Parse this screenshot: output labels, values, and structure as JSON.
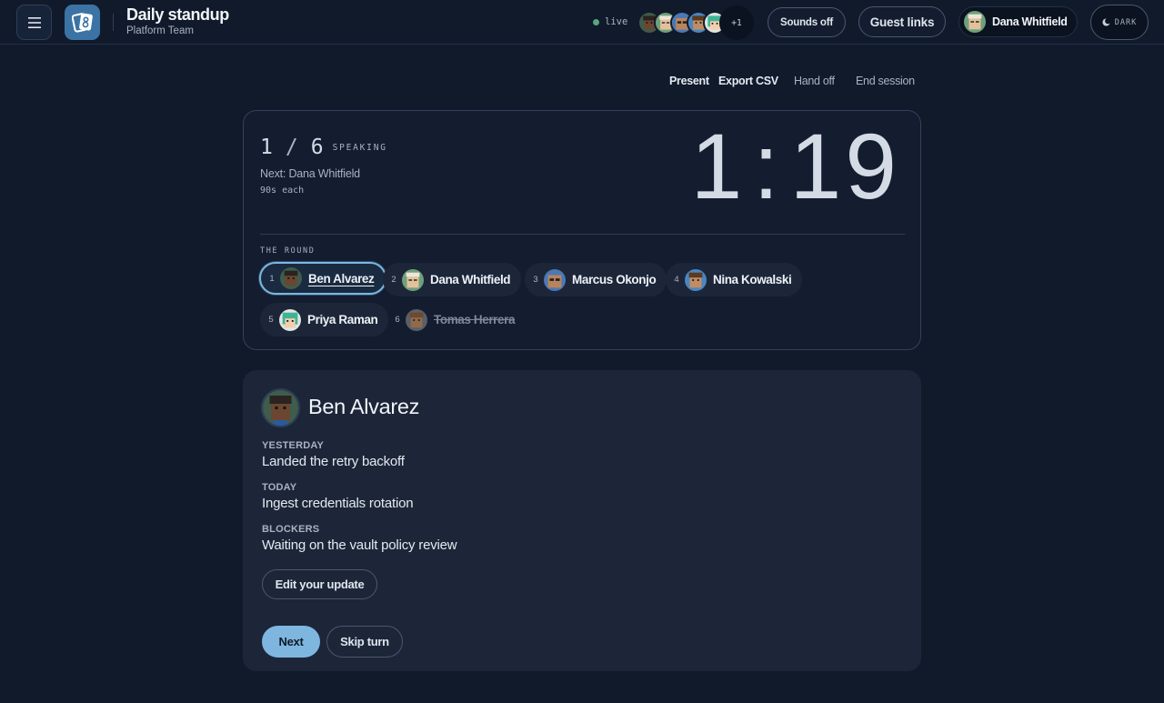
{
  "header": {
    "title": "Daily standup",
    "subtitle": "Platform Team",
    "live_label": "live",
    "more_participants": "+1",
    "sounds_label": "Sounds off",
    "guest_links_label": "Guest links",
    "current_user": "Dana Whitfield",
    "theme_label": "DARK"
  },
  "actions": {
    "present": "Present",
    "export": "Export CSV",
    "hand_off": "Hand off",
    "end_session": "End session"
  },
  "timer": {
    "current": "1",
    "slash": "/",
    "total": "6",
    "speaking_label": "SPEAKING",
    "next_up": "Next: Dana Whitfield",
    "per_person": "90s each",
    "remaining": "1:19",
    "round_label": "THE ROUND"
  },
  "round": [
    {
      "index": "1",
      "name": "Ben Alvarez",
      "state": "active"
    },
    {
      "index": "2",
      "name": "Dana Whitfield",
      "state": "pending"
    },
    {
      "index": "3",
      "name": "Marcus Okonjo",
      "state": "pending"
    },
    {
      "index": "4",
      "name": "Nina Kowalski",
      "state": "pending"
    },
    {
      "index": "5",
      "name": "Priya Raman",
      "state": "pending"
    },
    {
      "index": "6",
      "name": "Tomas Herrera",
      "state": "skipped"
    }
  ],
  "update": {
    "speaker": "Ben Alvarez",
    "yesterday_label": "YESTERDAY",
    "yesterday": "Landed the retry backoff",
    "today_label": "TODAY",
    "today": "Ingest credentials rotation",
    "blockers_label": "BLOCKERS",
    "blockers": "Waiting on the vault policy review",
    "edit_label": "Edit your update",
    "next_label": "Next",
    "skip_label": "Skip turn"
  },
  "colors": {
    "background": "#111a2b",
    "accent": "#7fb6df",
    "live": "#5ba67f"
  }
}
